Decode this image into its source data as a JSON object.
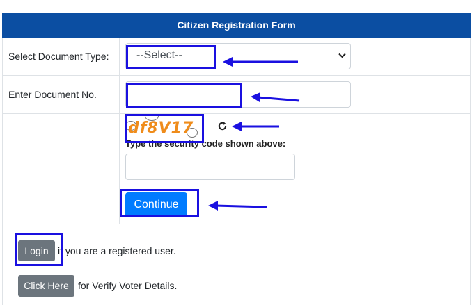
{
  "form": {
    "title": "Citizen Registration Form",
    "document_type": {
      "label": "Select Document Type:",
      "selected": "--Select--"
    },
    "document_number": {
      "label": "Enter Document No.",
      "value": ""
    },
    "captcha": {
      "code": "df8V17",
      "instruction": "Type the security code shown above:",
      "value": ""
    },
    "continue_label": "Continue"
  },
  "footer": {
    "login_label": "Login",
    "login_text": "if you are a registered user.",
    "click_here_label": "Click Here",
    "click_here_text": "for Verify Voter Details."
  },
  "annotation_color": "#1a10e0",
  "icons": {
    "refresh": "refresh-icon",
    "dropdown": "chevron-down-icon"
  }
}
